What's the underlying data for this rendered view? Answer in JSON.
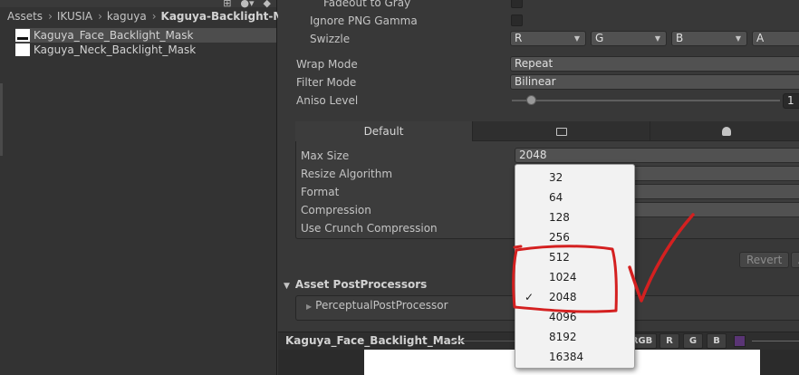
{
  "project": {
    "breadcrumb": [
      "Assets",
      "IKUSIA",
      "kaguya",
      "Kaguya-Backlight-Ma"
    ],
    "breadcrumb_sep": "›",
    "files": [
      {
        "name": "Kaguya_Face_Backlight_Mask",
        "selected": true
      },
      {
        "name": "Kaguya_Neck_Backlight_Mask",
        "selected": false
      }
    ]
  },
  "inspector": {
    "fadeout_label": "Fadeout to Gray",
    "ignore_png_gamma_label": "Ignore PNG Gamma",
    "swizzle": {
      "label": "Swizzle",
      "r": "R",
      "g": "G",
      "b": "B",
      "a": "A"
    },
    "wrap_mode": {
      "label": "Wrap Mode",
      "value": "Repeat"
    },
    "filter_mode": {
      "label": "Filter Mode",
      "value": "Bilinear"
    },
    "aniso_level": {
      "label": "Aniso Level",
      "value": "1",
      "slider_fraction": 0.06
    },
    "tabs": {
      "default": "Default"
    },
    "platform": {
      "max_size": {
        "label": "Max Size",
        "value": "2048"
      },
      "resize_algorithm_label": "Resize Algorithm",
      "format_label": "Format",
      "compression_label": "Compression",
      "use_crunch_label": "Use Crunch Compression"
    },
    "revert_label": "Revert",
    "apply_label": "A",
    "post_processors": {
      "header": "Asset PostProcessors",
      "item": "PerceptualPostProcessor"
    },
    "preview": {
      "title": "Kaguya_Face_Backlight_Mask",
      "channels": [
        "RGB",
        "R",
        "G",
        "B"
      ]
    }
  },
  "menu": {
    "options": [
      "32",
      "64",
      "128",
      "256",
      "512",
      "1024",
      "2048",
      "4096",
      "8192",
      "16384"
    ],
    "checked": "2048",
    "check_glyph": "✓"
  },
  "colors": {
    "annotation": "#d42020",
    "menu_bg": "#f2f2f2",
    "panel_bg": "#383838"
  }
}
